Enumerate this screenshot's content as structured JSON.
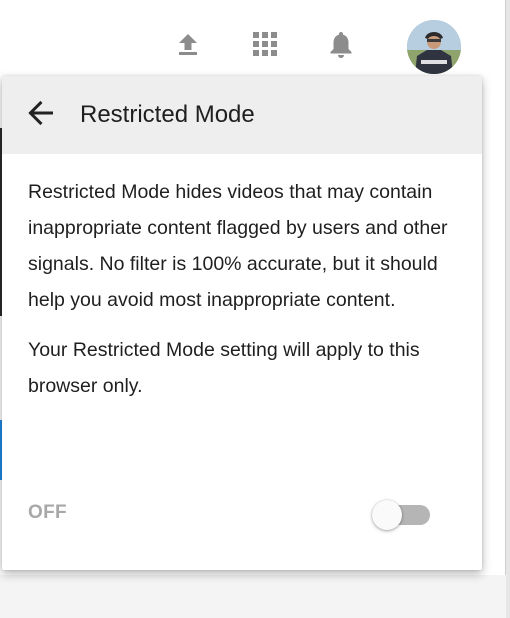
{
  "topbar": {
    "icons": {
      "upload": "upload-icon",
      "apps": "apps-grid-icon",
      "notifications": "bell-icon"
    },
    "icon_color": "#8c8c8c"
  },
  "panel": {
    "title": "Restricted Mode",
    "back_icon": "arrow-left-icon",
    "description": "Restricted Mode hides videos that may contain inappropriate content flagged by users and other signals. No filter is 100% accurate, but it should help you avoid most inappropriate content.",
    "scope_note": "Your Restricted Mode setting will apply to this browser only.",
    "toggle": {
      "label": "OFF",
      "enabled": false
    },
    "header_bg": "#eeeeee"
  }
}
